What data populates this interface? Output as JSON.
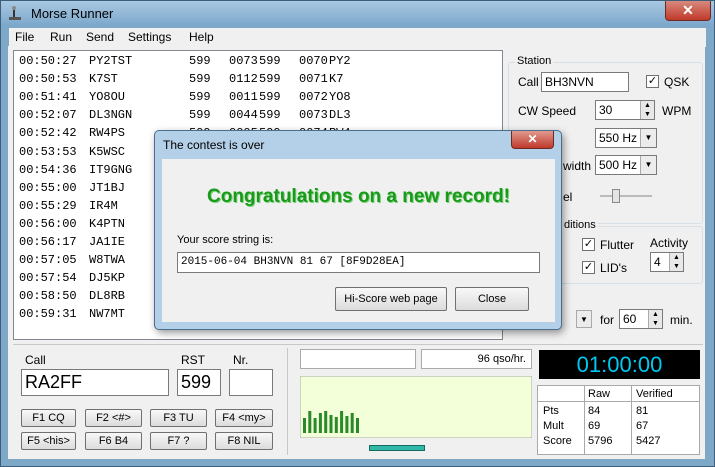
{
  "window": {
    "title": "Morse Runner",
    "close_label": "✕"
  },
  "menu": [
    "File",
    "Run",
    "Send",
    "Settings",
    "Help"
  ],
  "log": [
    [
      "00:50:27",
      "PY2TST",
      "599",
      "0073",
      "599",
      "0070",
      "PY2"
    ],
    [
      "00:50:53",
      "K7ST",
      "599",
      "0112",
      "599",
      "0071",
      "K7"
    ],
    [
      "00:51:41",
      "YO8OU",
      "599",
      "0011",
      "599",
      "0072",
      "YO8"
    ],
    [
      "00:52:07",
      "DL3NGN",
      "599",
      "0044",
      "599",
      "0073",
      "DL3"
    ],
    [
      "00:52:42",
      "RW4PS",
      "599",
      "0005",
      "599",
      "0074",
      "RW4"
    ],
    [
      "00:53:53",
      "K5WSC",
      "",
      "",
      "",
      "",
      ""
    ],
    [
      "00:54:36",
      "IT9GNG",
      "",
      "",
      "",
      "",
      ""
    ],
    [
      "00:55:00",
      "JT1BJ",
      "",
      "",
      "",
      "",
      ""
    ],
    [
      "00:55:29",
      "IR4M",
      "",
      "",
      "",
      "",
      ""
    ],
    [
      "00:56:00",
      "K4PTN",
      "",
      "",
      "",
      "",
      ""
    ],
    [
      "00:56:17",
      "JA1IE",
      "",
      "",
      "",
      "",
      ""
    ],
    [
      "00:57:05",
      "W8TWA",
      "",
      "",
      "",
      "",
      ""
    ],
    [
      "00:57:54",
      "DJ5KP",
      "",
      "",
      "",
      "",
      ""
    ],
    [
      "00:58:50",
      "DL8RB",
      "",
      "",
      "",
      "",
      ""
    ],
    [
      "00:59:31",
      "NW7MT",
      "",
      "",
      "",
      "",
      ""
    ]
  ],
  "station": {
    "title": "Station",
    "call_label": "Call",
    "call_value": "BH3NVN",
    "qsk_label": "QSK",
    "qsk_checked": true,
    "cw_speed_label": "CW Speed",
    "cw_speed_value": "30",
    "wpm_label": "WPM",
    "pitch_value": "550 Hz",
    "bandwidth_label": "width",
    "bandwidth_value": "500 Hz",
    "volume_label": "el"
  },
  "conditions": {
    "title": "ditions",
    "flutter_label": "Flutter",
    "flutter_checked": true,
    "lids_label": "LID's",
    "lids_checked": true,
    "activity_label": "Activity",
    "activity_value": "4"
  },
  "run": {
    "for_label": "for",
    "minutes_value": "60",
    "min_label": "min."
  },
  "entry": {
    "call_label": "Call",
    "call_value": "RA2FF",
    "rst_label": "RST",
    "rst_value": "599",
    "nr_label": "Nr.",
    "nr_value": ""
  },
  "fkeys": [
    [
      "F1 CQ",
      "F2 <#>",
      "F3 TU",
      "F4 <my>"
    ],
    [
      "F5 <his>",
      "F6 B4",
      "F7 ?",
      "F8 NIL"
    ]
  ],
  "rate": {
    "qso_rate": "96 qso/hr."
  },
  "rate_chart": {
    "values": [
      15,
      22,
      15,
      20,
      22,
      18,
      16,
      22,
      17,
      20,
      15
    ]
  },
  "clock": "01:00:00",
  "score_table": {
    "headers": [
      "",
      "Raw",
      "Verified"
    ],
    "rows": [
      [
        "Pts",
        "84",
        "81"
      ],
      [
        "Mult",
        "69",
        "67"
      ],
      [
        "Score",
        "5796",
        "5427"
      ]
    ]
  },
  "dialog": {
    "title": "The contest is over",
    "close_label": "✕",
    "headline": "Congratulations on a new record!",
    "score_label": "Your score string is:",
    "score_string": "2015-06-04 BH3NVN 81 67 [8F9D28EA]",
    "hiscore_button": "Hi-Score web page",
    "close_button": "Close"
  },
  "colors": {
    "clock_text": "#00c8f0",
    "headline": "#1a9a1a",
    "bars": "#2a8a2a",
    "chart_bg": "#f2ffd8"
  }
}
